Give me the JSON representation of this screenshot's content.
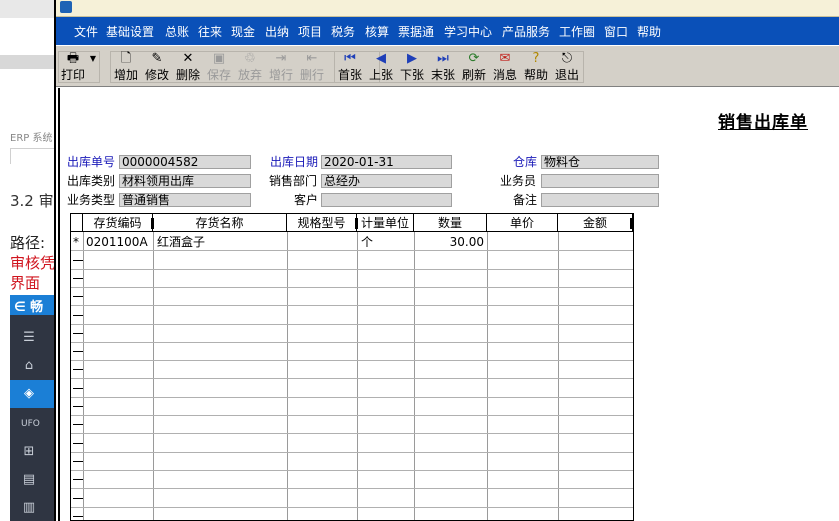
{
  "background": {
    "erp_text": "ERP 系统",
    "section_text": "3.2 审",
    "path_text": "路径:",
    "red_line1": "审核凭",
    "red_line2": "界面",
    "app_logo": "∈ 畅"
  },
  "menu": [
    "文件",
    "基础设置",
    "总账",
    "往来",
    "现金",
    "出纳",
    "项目",
    "税务",
    "核算",
    "票据通",
    "学习中心",
    "产品服务",
    "工作圈",
    "窗口",
    "帮助"
  ],
  "toolbar": {
    "print": "打印",
    "add": "增加",
    "edit": "修改",
    "delete": "删除",
    "save": "保存",
    "abandon": "放弃",
    "add_row": "增行",
    "del_row": "删行",
    "first": "首张",
    "prev": "上张",
    "next": "下张",
    "last": "末张",
    "refresh": "刷新",
    "message": "消息",
    "help": "帮助",
    "exit": "退出"
  },
  "form": {
    "title": "销售出库单",
    "doc_no_label": "出库单号",
    "doc_no": "0000004582",
    "date_label": "出库日期",
    "date": "2020-01-31",
    "warehouse_label": "仓库",
    "warehouse": "物料仓",
    "category_label": "出库类别",
    "category": "材料领用出库",
    "dept_label": "销售部门",
    "dept": "总经办",
    "salesman_label": "业务员",
    "salesman": "",
    "biz_type_label": "业务类型",
    "biz_type": "普通销售",
    "customer_label": "客户",
    "customer": "",
    "remark_label": "备注",
    "remark": ""
  },
  "grid": {
    "columns": [
      "存货编码",
      "存货名称",
      "规格型号",
      "计量单位",
      "数量",
      "单价",
      "金额"
    ],
    "rows": [
      {
        "marker": "*",
        "code": "0201100A",
        "name": "红酒盒子",
        "spec": "",
        "unit": "个",
        "qty": "30.00",
        "price": "",
        "amount": ""
      }
    ]
  },
  "colors": {
    "menu_bg": "#0a50b8",
    "toolbar_bg": "#d4d0c8",
    "field_bg": "#d9d9d9",
    "label_blue": "#1a1ab8"
  }
}
